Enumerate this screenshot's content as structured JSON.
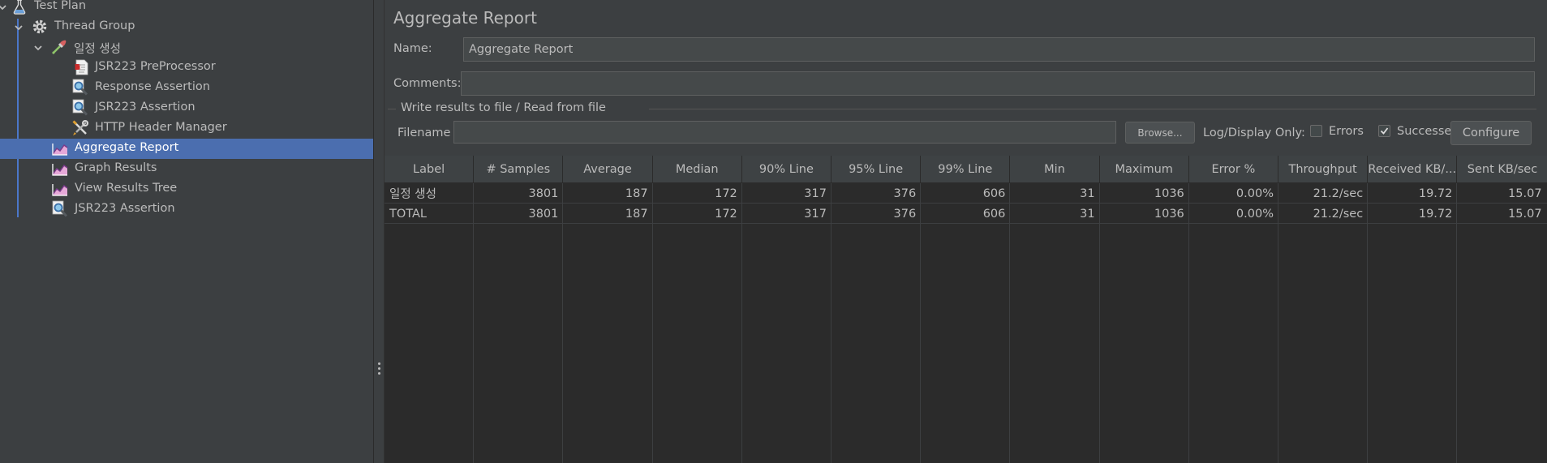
{
  "tree": {
    "items": [
      {
        "label": "Test Plan",
        "icon": "flask-icon",
        "expanded": true
      },
      {
        "label": "Thread Group",
        "icon": "gear-icon",
        "expanded": true
      },
      {
        "label": "일정 생성",
        "icon": "pipette-sampler-icon",
        "expanded": true
      },
      {
        "label": "JSR223 PreProcessor",
        "icon": "script-document-icon"
      },
      {
        "label": "Response Assertion",
        "icon": "magnifier-assertion-icon"
      },
      {
        "label": "JSR223 Assertion",
        "icon": "magnifier-assertion-icon"
      },
      {
        "label": "HTTP Header Manager",
        "icon": "tools-icon"
      },
      {
        "label": "Aggregate Report",
        "icon": "listener-chart-icon",
        "selected": true
      },
      {
        "label": "Graph Results",
        "icon": "listener-chart-icon"
      },
      {
        "label": "View Results Tree",
        "icon": "listener-chart-icon"
      },
      {
        "label": "JSR223 Assertion",
        "icon": "magnifier-assertion-icon"
      }
    ]
  },
  "panel": {
    "title": "Aggregate Report",
    "name_label": "Name:",
    "name_value": "Aggregate Report",
    "comments_label": "Comments:",
    "comments_value": "",
    "file_section_title": "Write results to file / Read from file",
    "filename_label": "Filename",
    "filename_value": "",
    "browse_label": "Browse...",
    "log_display_label": "Log/Display Only:",
    "errors_label": "Errors",
    "errors_checked": false,
    "successes_label": "Successes",
    "successes_checked": true,
    "configure_label": "Configure"
  },
  "table": {
    "columns": [
      "Label",
      "# Samples",
      "Average",
      "Median",
      "90% Line",
      "95% Line",
      "99% Line",
      "Min",
      "Maximum",
      "Error %",
      "Throughput",
      "Received KB/...",
      "Sent KB/sec"
    ],
    "rows": [
      [
        "일정 생성",
        "3801",
        "187",
        "172",
        "317",
        "376",
        "606",
        "31",
        "1036",
        "0.00%",
        "21.2/sec",
        "19.72",
        "15.07"
      ],
      [
        "TOTAL",
        "3801",
        "187",
        "172",
        "317",
        "376",
        "606",
        "31",
        "1036",
        "0.00%",
        "21.2/sec",
        "19.72",
        "15.07"
      ]
    ]
  },
  "colors": {
    "background": "#3c3f41",
    "table_background": "#2b2b2b",
    "selection": "#4b6eaf",
    "tree_guide": "#4b77c9",
    "text": "#bbbbbb"
  }
}
